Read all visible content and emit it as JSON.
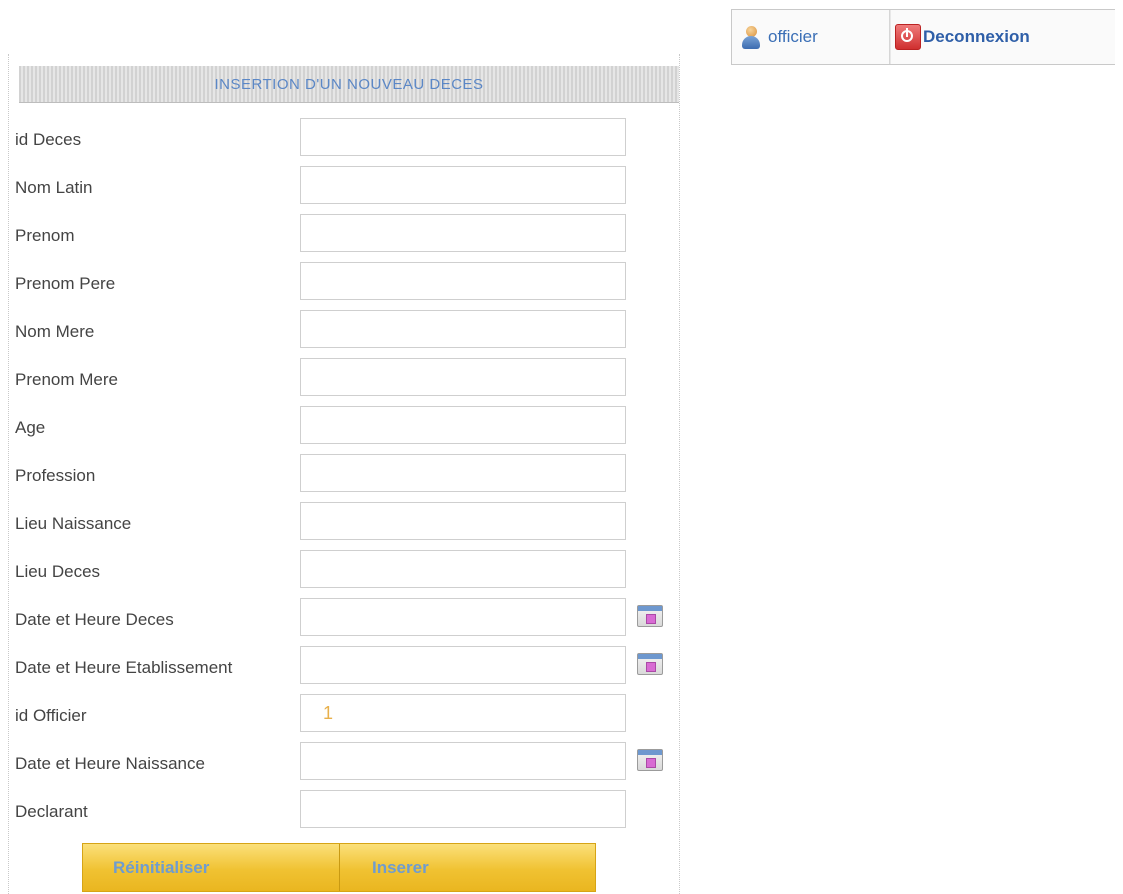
{
  "userbar": {
    "user_label": "officier",
    "logout_label": "Deconnexion"
  },
  "form": {
    "title": "INSERTION D'UN NOUVEAU DECES",
    "fields": [
      {
        "label": "id Deces",
        "value": ""
      },
      {
        "label": "Nom Latin",
        "value": ""
      },
      {
        "label": "Prenom",
        "value": ""
      },
      {
        "label": "Prenom Pere",
        "value": ""
      },
      {
        "label": "Nom Mere",
        "value": ""
      },
      {
        "label": "Prenom Mere",
        "value": ""
      },
      {
        "label": "Age",
        "value": ""
      },
      {
        "label": "Profession",
        "value": ""
      },
      {
        "label": "Lieu Naissance",
        "value": ""
      },
      {
        "label": "Lieu Deces",
        "value": ""
      },
      {
        "label": "Date et Heure Deces",
        "value": ""
      },
      {
        "label": "Date et Heure Etablissement",
        "value": ""
      },
      {
        "label": "id Officier",
        "value": "1"
      },
      {
        "label": "Date et Heure Naissance",
        "value": ""
      },
      {
        "label": "Declarant",
        "value": ""
      }
    ],
    "buttons": {
      "reset": "Réinitialiser",
      "insert": "Inserer"
    }
  }
}
